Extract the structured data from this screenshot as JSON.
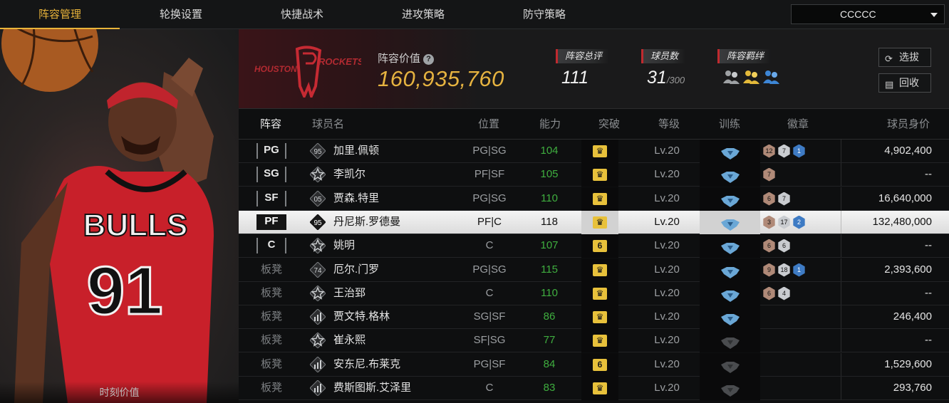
{
  "nav": {
    "tabs": [
      {
        "label": "阵容管理",
        "active": true
      },
      {
        "label": "轮换设置",
        "active": false
      },
      {
        "label": "快捷战术",
        "active": false
      },
      {
        "label": "进攻策略",
        "active": false
      },
      {
        "label": "防守策略",
        "active": false
      }
    ],
    "lineup_select": "CCCCC"
  },
  "left_panel": {
    "footer": "时刻价值",
    "jersey_text": "BULLS",
    "jersey_number": "91"
  },
  "team": {
    "logo_words": [
      "HOUSTON",
      "ROCKETS"
    ],
    "value_label": "阵容价值",
    "value": "160,935,760",
    "rating_label": "阵容总评",
    "rating": "111",
    "players_label": "球员数",
    "players_count": "31",
    "players_max": "/300",
    "bond_label": "阵容羁绊",
    "buttons": {
      "select": "选拔",
      "recycle": "回收"
    }
  },
  "table": {
    "headers": [
      "阵容",
      "球员名",
      "位置",
      "能力",
      "突破",
      "等级",
      "训练",
      "徽章",
      "球员身价"
    ],
    "rows": [
      {
        "slot": "PG",
        "starter": true,
        "icon": "95",
        "name": "加里.佩顿",
        "position": "PG|SG",
        "ability": "104",
        "breakthrough": "crown",
        "level": "Lv.20",
        "train": "on",
        "badges": [
          {
            "t": "bronze",
            "v": "12"
          },
          {
            "t": "silver",
            "v": "7"
          },
          {
            "t": "blue",
            "v": "1"
          }
        ],
        "worth": "4,902,400",
        "selected": false
      },
      {
        "slot": "SG",
        "starter": true,
        "icon": "star",
        "name": "李凯尔",
        "position": "PF|SF",
        "ability": "105",
        "breakthrough": "crown",
        "level": "Lv.20",
        "train": "on",
        "badges": [
          {
            "t": "bronze",
            "v": "7"
          }
        ],
        "worth": "--",
        "selected": false
      },
      {
        "slot": "SF",
        "starter": true,
        "icon": "05",
        "name": "贾森.特里",
        "position": "PG|SG",
        "ability": "110",
        "breakthrough": "crown",
        "level": "Lv.20",
        "train": "on",
        "badges": [
          {
            "t": "bronze",
            "v": "6"
          },
          {
            "t": "silver",
            "v": "7"
          }
        ],
        "worth": "16,640,000",
        "selected": false
      },
      {
        "slot": "PF",
        "starter": true,
        "icon": "95",
        "name": "丹尼斯.罗德曼",
        "position": "PF|C",
        "ability": "118",
        "breakthrough": "crown",
        "level": "Lv.20",
        "train": "on",
        "badges": [
          {
            "t": "bronze",
            "v": "3"
          },
          {
            "t": "silver",
            "v": "17"
          },
          {
            "t": "blue",
            "v": "2"
          }
        ],
        "worth": "132,480,000",
        "selected": true
      },
      {
        "slot": "C",
        "starter": true,
        "icon": "star",
        "name": "姚明",
        "position": "C",
        "ability": "107",
        "breakthrough": "6",
        "level": "Lv.20",
        "train": "on",
        "badges": [
          {
            "t": "bronze",
            "v": "6"
          },
          {
            "t": "silver",
            "v": "6"
          }
        ],
        "worth": "--",
        "selected": false
      },
      {
        "slot": "板凳",
        "starter": false,
        "icon": "74",
        "name": "厄尔.门罗",
        "position": "PG|SG",
        "ability": "115",
        "breakthrough": "crown",
        "level": "Lv.20",
        "train": "on",
        "badges": [
          {
            "t": "bronze",
            "v": "9"
          },
          {
            "t": "silver",
            "v": "18"
          },
          {
            "t": "blue",
            "v": "1"
          }
        ],
        "worth": "2,393,600",
        "selected": false
      },
      {
        "slot": "板凳",
        "starter": false,
        "icon": "star",
        "name": "王治郅",
        "position": "C",
        "ability": "110",
        "breakthrough": "crown",
        "level": "Lv.20",
        "train": "on",
        "badges": [
          {
            "t": "bronze",
            "v": "6"
          },
          {
            "t": "silver",
            "v": "4"
          }
        ],
        "worth": "--",
        "selected": false
      },
      {
        "slot": "板凳",
        "starter": false,
        "icon": "bars",
        "name": "贾文特.格林",
        "position": "SG|SF",
        "ability": "86",
        "breakthrough": "crown",
        "level": "Lv.20",
        "train": "on",
        "badges": [],
        "worth": "246,400",
        "selected": false
      },
      {
        "slot": "板凳",
        "starter": false,
        "icon": "star",
        "name": "崔永熙",
        "position": "SF|SG",
        "ability": "77",
        "breakthrough": "crown",
        "level": "Lv.20",
        "train": "off",
        "badges": [],
        "worth": "--",
        "selected": false
      },
      {
        "slot": "板凳",
        "starter": false,
        "icon": "bars",
        "name": "安东尼.布莱克",
        "position": "PG|SF",
        "ability": "84",
        "breakthrough": "6",
        "level": "Lv.20",
        "train": "off",
        "badges": [],
        "worth": "1,529,600",
        "selected": false
      },
      {
        "slot": "板凳",
        "starter": false,
        "icon": "bars",
        "name": "费斯图斯.艾泽里",
        "position": "C",
        "ability": "83",
        "breakthrough": "crown",
        "level": "Lv.20",
        "train": "off",
        "badges": [],
        "worth": "293,760",
        "selected": false
      }
    ]
  },
  "colors": {
    "accent": "#e9b43a",
    "ability": "#3fae3f",
    "red_bar": "#c02a2f",
    "badge_blue": "#3e7bc4"
  }
}
